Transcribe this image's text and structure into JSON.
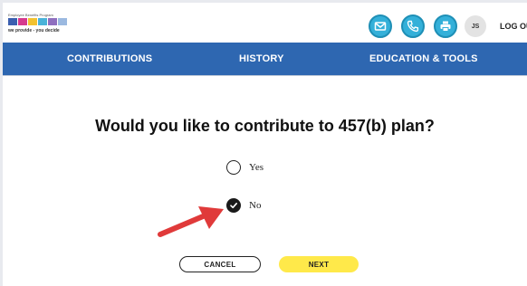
{
  "header": {
    "logo_tagline": "Employee Benefits Program",
    "logo_slogan": "we provide - you decide",
    "logo_colors": [
      "#3b5fb0",
      "#d63a8e",
      "#f2c230",
      "#4ab3d9",
      "#8f6fbf",
      "#9bb9e0"
    ],
    "icons": [
      "mail-icon",
      "phone-icon",
      "print-icon"
    ],
    "icon_color": "#34b0d9",
    "user_initials": "JS",
    "logout_label": "LOG OU"
  },
  "nav": {
    "tabs": [
      {
        "label": "CONTRIBUTIONS"
      },
      {
        "label": "HISTORY"
      },
      {
        "label": "EDUCATION & TOOLS"
      }
    ],
    "background": "#2e67b1"
  },
  "main": {
    "question": "Would you like to contribute to 457(b) plan?",
    "options": [
      {
        "label": "Yes",
        "selected": false
      },
      {
        "label": "No",
        "selected": true
      }
    ],
    "arrow_color": "#e03a3a"
  },
  "actions": {
    "cancel_label": "CANCEL",
    "next_label": "NEXT",
    "next_color": "#ffe94a"
  }
}
